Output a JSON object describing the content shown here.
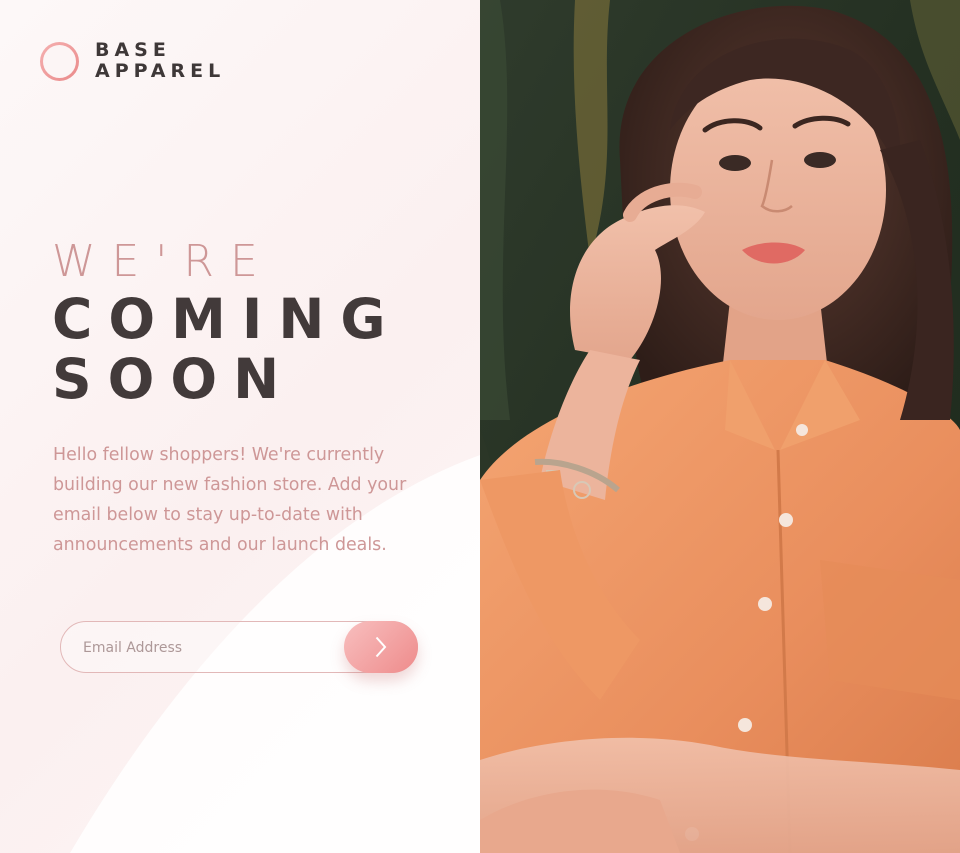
{
  "brand": {
    "line1": "BASE",
    "line2": "APPAREL",
    "logo_icon": "ring-icon"
  },
  "hero": {
    "intro": "WE'RE",
    "line1": "COMING",
    "line2": "SOON"
  },
  "description": "Hello fellow shoppers! We're currently building our new fashion store. Add your email below to stay up-to-date with announcements and our launch deals.",
  "form": {
    "email_placeholder": "Email Address",
    "email_value": "",
    "submit_icon": "chevron-right-icon"
  },
  "photo": {
    "subject": "woman-in-orange-shirt-photo"
  },
  "colors": {
    "accent": "#ce9797",
    "dark_text": "#423a3a",
    "gradient_start": "#f8bfbf",
    "gradient_end": "#ee8b8b",
    "background": "#fcf5f5"
  }
}
